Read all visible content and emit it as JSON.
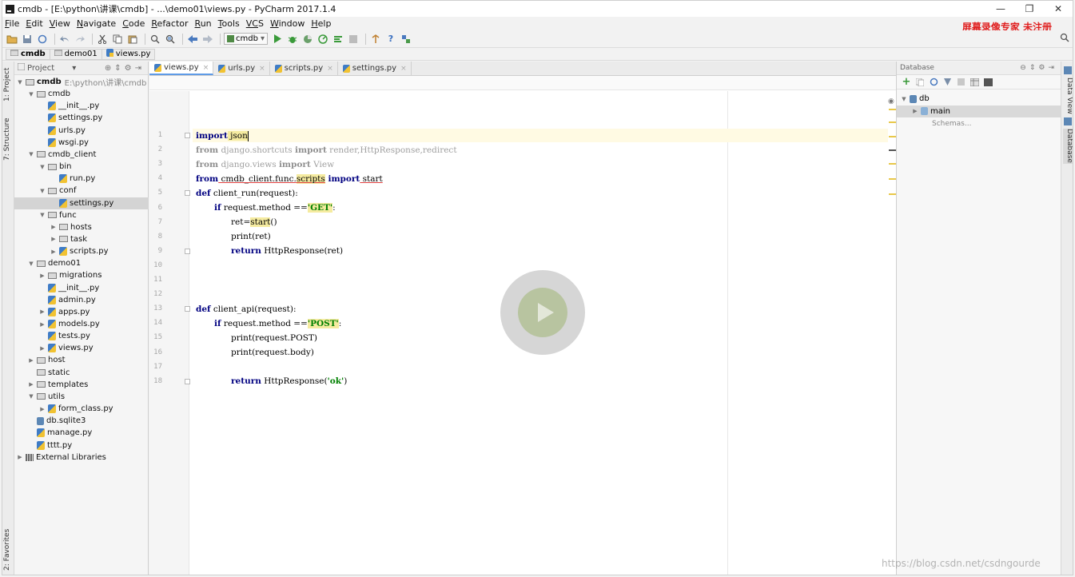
{
  "window": {
    "title": "cmdb - [E:\\python\\讲课\\cmdb] - ...\\demo01\\views.py - PyCharm 2017.1.4",
    "minimize": "—",
    "restore": "❐",
    "close": "✕"
  },
  "menu": [
    {
      "mnemonic": "F",
      "rest": "ile"
    },
    {
      "mnemonic": "E",
      "rest": "dit"
    },
    {
      "mnemonic": "V",
      "rest": "iew"
    },
    {
      "mnemonic": "N",
      "rest": "avigate"
    },
    {
      "mnemonic": "C",
      "rest": "ode"
    },
    {
      "mnemonic": "R",
      "rest": "efactor"
    },
    {
      "mnemonic": "R",
      "rest": "un"
    },
    {
      "mnemonic": "T",
      "rest": "ools"
    },
    {
      "mnemonic": "VC",
      "rest": "S"
    },
    {
      "mnemonic": "W",
      "rest": "indow"
    },
    {
      "mnemonic": "H",
      "rest": "elp"
    }
  ],
  "watermark_top": "屏幕录像专家 未注册",
  "toolbar": {
    "run_config": "cmdb",
    "run_config_arrow": "▾",
    "help": "?"
  },
  "breadcrumbs": [
    "cmdb",
    "demo01",
    "views.py"
  ],
  "project_panel": {
    "title": "Project",
    "title_arrow": "▾",
    "tree": [
      {
        "label": "cmdb",
        "path": "E:\\python\\讲课\\cmdb",
        "indent": 0,
        "arrow": "▼",
        "icon": "folder",
        "bold": true
      },
      {
        "label": "cmdb",
        "indent": 1,
        "arrow": "▼",
        "icon": "folder"
      },
      {
        "label": "__init__.py",
        "indent": 2,
        "arrow": "",
        "icon": "python"
      },
      {
        "label": "settings.py",
        "indent": 2,
        "arrow": "",
        "icon": "python"
      },
      {
        "label": "urls.py",
        "indent": 2,
        "arrow": "",
        "icon": "python"
      },
      {
        "label": "wsgi.py",
        "indent": 2,
        "arrow": "",
        "icon": "python"
      },
      {
        "label": "cmdb_client",
        "indent": 1,
        "arrow": "▼",
        "icon": "folder"
      },
      {
        "label": "bin",
        "indent": 2,
        "arrow": "▼",
        "icon": "folder"
      },
      {
        "label": "run.py",
        "indent": 3,
        "arrow": "",
        "icon": "python"
      },
      {
        "label": "conf",
        "indent": 2,
        "arrow": "▼",
        "icon": "folder"
      },
      {
        "label": "settings.py",
        "indent": 3,
        "arrow": "",
        "icon": "python",
        "selected": true
      },
      {
        "label": "func",
        "indent": 2,
        "arrow": "▼",
        "icon": "folder"
      },
      {
        "label": "hosts",
        "indent": 3,
        "arrow": "▶",
        "icon": "folder"
      },
      {
        "label": "task",
        "indent": 3,
        "arrow": "▶",
        "icon": "folder"
      },
      {
        "label": "scripts.py",
        "indent": 3,
        "arrow": "▶",
        "icon": "python"
      },
      {
        "label": "demo01",
        "indent": 1,
        "arrow": "▼",
        "icon": "folder"
      },
      {
        "label": "migrations",
        "indent": 2,
        "arrow": "▶",
        "icon": "folder"
      },
      {
        "label": "__init__.py",
        "indent": 2,
        "arrow": "",
        "icon": "python"
      },
      {
        "label": "admin.py",
        "indent": 2,
        "arrow": "",
        "icon": "python"
      },
      {
        "label": "apps.py",
        "indent": 2,
        "arrow": "▶",
        "icon": "python"
      },
      {
        "label": "models.py",
        "indent": 2,
        "arrow": "▶",
        "icon": "python"
      },
      {
        "label": "tests.py",
        "indent": 2,
        "arrow": "",
        "icon": "python"
      },
      {
        "label": "views.py",
        "indent": 2,
        "arrow": "▶",
        "icon": "python"
      },
      {
        "label": "host",
        "indent": 1,
        "arrow": "▶",
        "icon": "folder"
      },
      {
        "label": "static",
        "indent": 1,
        "arrow": "",
        "icon": "folder"
      },
      {
        "label": "templates",
        "indent": 1,
        "arrow": "▶",
        "icon": "folder"
      },
      {
        "label": "utils",
        "indent": 1,
        "arrow": "▼",
        "icon": "folder"
      },
      {
        "label": "form_class.py",
        "indent": 2,
        "arrow": "▶",
        "icon": "python"
      },
      {
        "label": "db.sqlite3",
        "indent": 1,
        "arrow": "",
        "icon": "database"
      },
      {
        "label": "manage.py",
        "indent": 1,
        "arrow": "",
        "icon": "python"
      },
      {
        "label": "tttt.py",
        "indent": 1,
        "arrow": "",
        "icon": "python"
      },
      {
        "label": "External Libraries",
        "indent": 0,
        "arrow": "▶",
        "icon": "library"
      }
    ]
  },
  "left_strip": {
    "project": "1: Project",
    "structure": "7: Structure",
    "favorites": "2: Favorites"
  },
  "editor": {
    "tabs": [
      {
        "label": "views.py",
        "active": true
      },
      {
        "label": "urls.py",
        "active": false
      },
      {
        "label": "scripts.py",
        "active": false
      },
      {
        "label": "settings.py",
        "active": false
      }
    ],
    "tab_close": "×",
    "line_numbers": [
      "1",
      "2",
      "3",
      "4",
      "5",
      "6",
      "7",
      "8",
      "9",
      "10",
      "11",
      "12",
      "13",
      "14",
      "15",
      "16",
      "17",
      "18"
    ],
    "code": {
      "l1": {
        "kw": "import",
        "rest": " json"
      },
      "l2": {
        "kw1": "from",
        "mod": " django.shortcuts ",
        "kw2": "import",
        "rest": " render,HttpResponse,redirect"
      },
      "l3": {
        "kw1": "from",
        "mod": " django.views ",
        "kw2": "import",
        "rest": " View"
      },
      "l4": {
        "kw1": "from",
        "mod_a": " cmdb_client.func.",
        "mod_b": "scripts",
        "kw2": " import",
        "rest": " start"
      },
      "l5": {
        "kw": "def",
        "rest": " client_run(request):"
      },
      "l6": {
        "kw": "if",
        "rest": " request.method ==",
        "str": "'GET'",
        "tail": ":"
      },
      "l7": {
        "a": "ret=",
        "b": "start",
        "c": "()"
      },
      "l8": {
        "text": "print(ret)"
      },
      "l9": {
        "kw": "return",
        "rest": " HttpResponse(ret)"
      },
      "l13": {
        "kw": "def",
        "rest": " client_api(request):"
      },
      "l14": {
        "kw": "if",
        "rest": " request.method ==",
        "str": "'POST'",
        "tail": ":"
      },
      "l15": {
        "text": "print(request.POST)"
      },
      "l16": {
        "text": "print(request.body)"
      },
      "l18": {
        "kw": "return",
        "rest": " HttpResponse(",
        "str": "'ok'",
        "tail": ")"
      }
    }
  },
  "database_panel": {
    "title": "Database",
    "tree": [
      {
        "label": "db",
        "arrow": "▼"
      },
      {
        "label": "main",
        "arrow": "▶",
        "selected": true
      },
      {
        "label": "Schemas...",
        "arrow": ""
      }
    ]
  },
  "right_strip": {
    "data_view": "Data View",
    "database": "Database"
  },
  "watermark_bottom": "https://blog.csdn.net/csdngourde",
  "colors": {
    "keyword": "#000080",
    "string": "#008000",
    "current_line": "#fffae3",
    "selection": "#d4d4d4",
    "tab_active_underline": "#5f9be6"
  }
}
